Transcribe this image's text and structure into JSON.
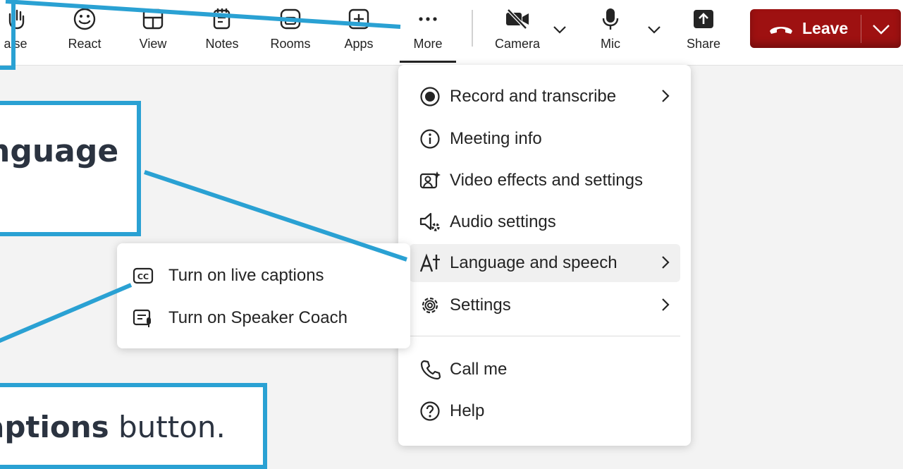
{
  "toolbar": {
    "raise_label": "aise",
    "react_label": "React",
    "view_label": "View",
    "notes_label": "Notes",
    "rooms_label": "Rooms",
    "apps_label": "Apps",
    "more_label": "More",
    "camera_label": "Camera",
    "mic_label": "Mic",
    "share_label": "Share",
    "leave_label": "Leave"
  },
  "menu": {
    "items": [
      {
        "label": "Record and transcribe",
        "icon": "record-icon",
        "has_submenu": true
      },
      {
        "label": "Meeting info",
        "icon": "info-icon",
        "has_submenu": false
      },
      {
        "label": "Video effects and settings",
        "icon": "video-effects-icon",
        "has_submenu": false
      },
      {
        "label": "Audio settings",
        "icon": "audio-settings-icon",
        "has_submenu": false
      },
      {
        "label": "Language and speech",
        "icon": "language-icon",
        "has_submenu": true,
        "highlighted": true
      },
      {
        "label": "Settings",
        "icon": "gear-icon",
        "has_submenu": true
      },
      {
        "label": "Call me",
        "icon": "phone-icon",
        "has_submenu": false
      },
      {
        "label": "Help",
        "icon": "help-icon",
        "has_submenu": false
      }
    ]
  },
  "submenu": {
    "items": [
      {
        "label": "Turn on live captions",
        "icon": "cc-icon"
      },
      {
        "label": "Turn on Speaker Coach",
        "icon": "speaker-coach-icon"
      }
    ]
  },
  "callouts": {
    "language_text": "nguage",
    "captions_bold": "aptions",
    "captions_rest": " button."
  },
  "colors": {
    "callout_border": "#2aa1d3",
    "leave_red": "#9e1111",
    "highlight": "#f0f0f0"
  }
}
